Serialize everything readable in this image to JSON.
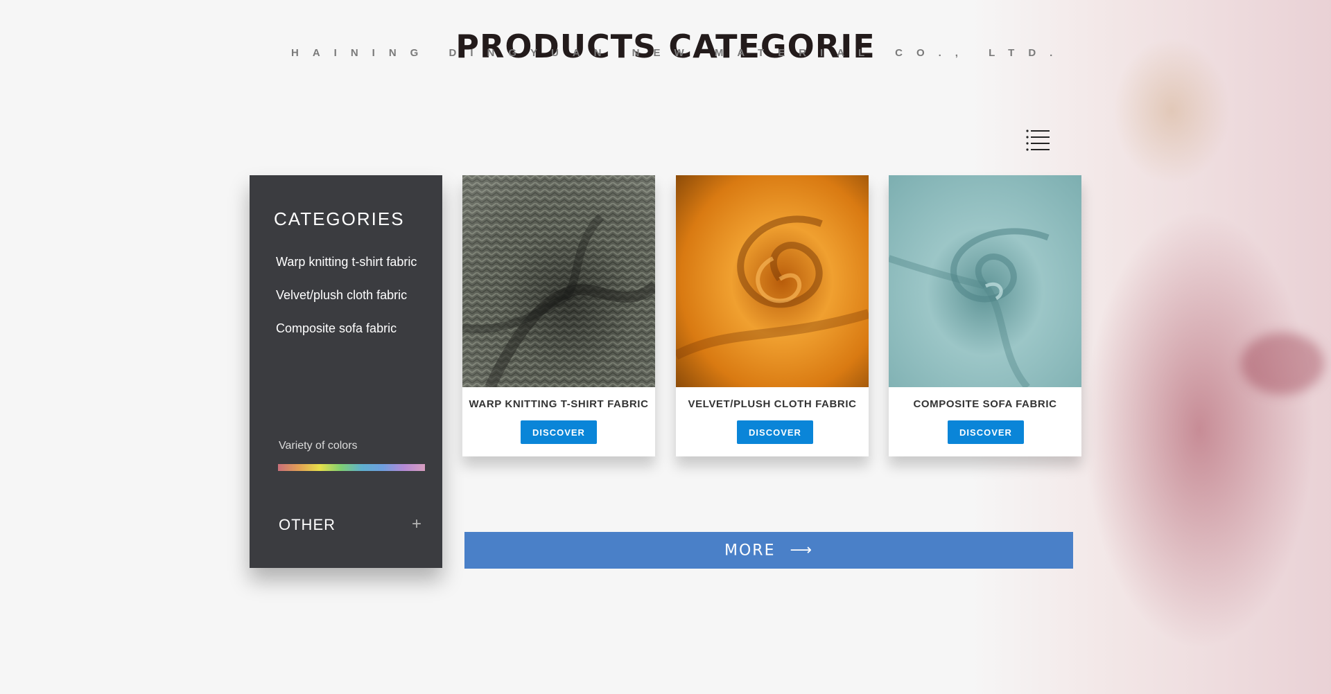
{
  "header": {
    "title": "PRODUCTS CATEGORIE",
    "subtitle": "HAINING DINGYUAN NEW MATERIAL CO., LTD."
  },
  "sidebar": {
    "title": "CATEGORIES",
    "items": [
      {
        "label": "Warp knitting t-shirt fabric"
      },
      {
        "label": "Velvet/plush cloth fabric"
      },
      {
        "label": "Composite sofa fabric"
      }
    ],
    "variety_label": "Variety of colors",
    "other_label": "OTHER",
    "other_icon": "+"
  },
  "products": [
    {
      "title": "WARP KNITTING T-SHIRT FABRIC",
      "button": "DISCOVER",
      "fabric_color": "#5b5f55"
    },
    {
      "title": "VELVET/PLUSH CLOTH FABRIC",
      "button": "DISCOVER",
      "fabric_color": "#e58a1e"
    },
    {
      "title": "COMPOSITE SOFA FABRIC",
      "button": "DISCOVER",
      "fabric_color": "#86b4b6"
    }
  ],
  "more": {
    "label": "MORE",
    "arrow": "⟶"
  },
  "icons": {
    "menu": "menu-list-icon"
  },
  "colors": {
    "accent": "#0a85d8",
    "more_bg": "#4a80c8",
    "sidebar_bg": "#3b3c40"
  }
}
